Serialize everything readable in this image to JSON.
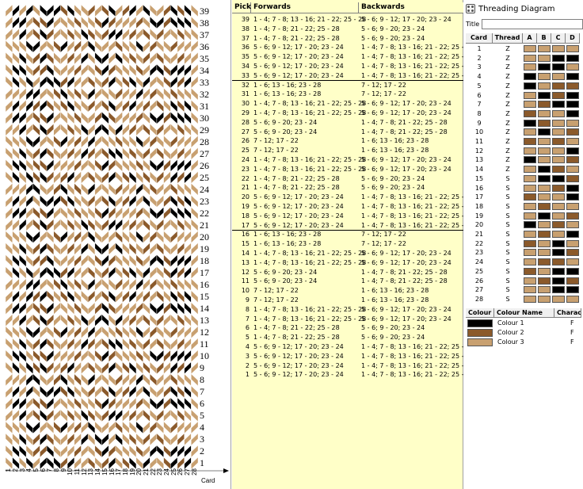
{
  "colors": {
    "colour1": "#000000",
    "colour2": "#8b5a2b",
    "colour3": "#c8a070",
    "panel_yellow": "#ffffc8"
  },
  "pattern": {
    "picks_shown": [
      "39",
      "38",
      "37",
      "36",
      "35",
      "34",
      "33",
      "32",
      "31",
      "30",
      "29",
      "28",
      "27",
      "26",
      "25",
      "24",
      "23",
      "22",
      "21",
      "20",
      "19",
      "18",
      "17",
      "16",
      "15",
      "14",
      "13",
      "12",
      "11",
      "10",
      "9",
      "8",
      "7",
      "6",
      "5",
      "4",
      "3",
      "2",
      "1"
    ],
    "cards_shown": [
      "1",
      "2",
      "3",
      "4",
      "5",
      "6",
      "7",
      "8",
      "9",
      "10",
      "11",
      "12",
      "13",
      "14",
      "15",
      "16",
      "17",
      "18",
      "19",
      "20",
      "21",
      "22",
      "23",
      "24",
      "25",
      "26",
      "27",
      "28"
    ],
    "card_axis_label": "Card"
  },
  "pick_list": {
    "headers": {
      "pick": "Pick",
      "forwards": "Forwards",
      "backwards": "Backwards"
    },
    "rows": [
      {
        "pick": "39",
        "fwd": "1 - 4; 7 - 8; 13 - 16; 21 - 22; 25 - 28",
        "bwd": "5 - 6; 9 - 12; 17 - 20; 23 - 24",
        "end": false
      },
      {
        "pick": "38",
        "fwd": "1 - 4; 7 - 8; 21 - 22; 25 - 28",
        "bwd": "5 - 6; 9 - 20; 23 - 24",
        "end": false
      },
      {
        "pick": "37",
        "fwd": "1 - 4; 7 - 8; 21 - 22; 25 - 28",
        "bwd": "5 - 6; 9 - 20; 23 - 24",
        "end": false
      },
      {
        "pick": "36",
        "fwd": "5 - 6; 9 - 12; 17 - 20; 23 - 24",
        "bwd": "1 - 4; 7 - 8; 13 - 16; 21 - 22; 25 - 28",
        "end": false
      },
      {
        "pick": "35",
        "fwd": "5 - 6; 9 - 12; 17 - 20; 23 - 24",
        "bwd": "1 - 4; 7 - 8; 13 - 16; 21 - 22; 25 - 28",
        "end": false
      },
      {
        "pick": "34",
        "fwd": "5 - 6; 9 - 12; 17 - 20; 23 - 24",
        "bwd": "1 - 4; 7 - 8; 13 - 16; 21 - 22; 25 - 28",
        "end": false
      },
      {
        "pick": "33",
        "fwd": "5 - 6; 9 - 12; 17 - 20; 23 - 24",
        "bwd": "1 - 4; 7 - 8; 13 - 16; 21 - 22; 25 - 28",
        "end": true
      },
      {
        "pick": "32",
        "fwd": "1 - 6; 13 - 16; 23 - 28",
        "bwd": "7 - 12; 17 - 22",
        "end": false
      },
      {
        "pick": "31",
        "fwd": "1 - 6; 13 - 16; 23 - 28",
        "bwd": "7 - 12; 17 - 22",
        "end": false
      },
      {
        "pick": "30",
        "fwd": "1 - 4; 7 - 8; 13 - 16; 21 - 22; 25 - 28",
        "bwd": "5 - 6; 9 - 12; 17 - 20; 23 - 24",
        "end": false
      },
      {
        "pick": "29",
        "fwd": "1 - 4; 7 - 8; 13 - 16; 21 - 22; 25 - 28",
        "bwd": "5 - 6; 9 - 12; 17 - 20; 23 - 24",
        "end": false
      },
      {
        "pick": "28",
        "fwd": "5 - 6; 9 - 20; 23 - 24",
        "bwd": "1 - 4; 7 - 8; 21 - 22; 25 - 28",
        "end": false
      },
      {
        "pick": "27",
        "fwd": "5 - 6; 9 - 20; 23 - 24",
        "bwd": "1 - 4; 7 - 8; 21 - 22; 25 - 28",
        "end": false
      },
      {
        "pick": "26",
        "fwd": "7 - 12; 17 - 22",
        "bwd": "1 - 6; 13 - 16; 23 - 28",
        "end": false
      },
      {
        "pick": "25",
        "fwd": "7 - 12; 17 - 22",
        "bwd": "1 - 6; 13 - 16; 23 - 28",
        "end": false
      },
      {
        "pick": "24",
        "fwd": "1 - 4; 7 - 8; 13 - 16; 21 - 22; 25 - 28",
        "bwd": "5 - 6; 9 - 12; 17 - 20; 23 - 24",
        "end": false
      },
      {
        "pick": "23",
        "fwd": "1 - 4; 7 - 8; 13 - 16; 21 - 22; 25 - 28",
        "bwd": "5 - 6; 9 - 12; 17 - 20; 23 - 24",
        "end": false
      },
      {
        "pick": "22",
        "fwd": "1 - 4; 7 - 8; 21 - 22; 25 - 28",
        "bwd": "5 - 6; 9 - 20; 23 - 24",
        "end": false
      },
      {
        "pick": "21",
        "fwd": "1 - 4; 7 - 8; 21 - 22; 25 - 28",
        "bwd": "5 - 6; 9 - 20; 23 - 24",
        "end": false
      },
      {
        "pick": "20",
        "fwd": "5 - 6; 9 - 12; 17 - 20; 23 - 24",
        "bwd": "1 - 4; 7 - 8; 13 - 16; 21 - 22; 25 - 28",
        "end": false
      },
      {
        "pick": "19",
        "fwd": "5 - 6; 9 - 12; 17 - 20; 23 - 24",
        "bwd": "1 - 4; 7 - 8; 13 - 16; 21 - 22; 25 - 28",
        "end": false
      },
      {
        "pick": "18",
        "fwd": "5 - 6; 9 - 12; 17 - 20; 23 - 24",
        "bwd": "1 - 4; 7 - 8; 13 - 16; 21 - 22; 25 - 28",
        "end": false
      },
      {
        "pick": "17",
        "fwd": "5 - 6; 9 - 12; 17 - 20; 23 - 24",
        "bwd": "1 - 4; 7 - 8; 13 - 16; 21 - 22; 25 - 28",
        "end": true
      },
      {
        "pick": "16",
        "fwd": "1 - 6; 13 - 16; 23 - 28",
        "bwd": "7 - 12; 17 - 22",
        "end": false
      },
      {
        "pick": "15",
        "fwd": "1 - 6; 13 - 16; 23 - 28",
        "bwd": "7 - 12; 17 - 22",
        "end": false
      },
      {
        "pick": "14",
        "fwd": "1 - 4; 7 - 8; 13 - 16; 21 - 22; 25 - 28",
        "bwd": "5 - 6; 9 - 12; 17 - 20; 23 - 24",
        "end": false
      },
      {
        "pick": "13",
        "fwd": "1 - 4; 7 - 8; 13 - 16; 21 - 22; 25 - 28",
        "bwd": "5 - 6; 9 - 12; 17 - 20; 23 - 24",
        "end": false
      },
      {
        "pick": "12",
        "fwd": "5 - 6; 9 - 20; 23 - 24",
        "bwd": "1 - 4; 7 - 8; 21 - 22; 25 - 28",
        "end": false
      },
      {
        "pick": "11",
        "fwd": "5 - 6; 9 - 20; 23 - 24",
        "bwd": "1 - 4; 7 - 8; 21 - 22; 25 - 28",
        "end": false
      },
      {
        "pick": "10",
        "fwd": "7 - 12; 17 - 22",
        "bwd": "1 - 6; 13 - 16; 23 - 28",
        "end": false
      },
      {
        "pick": "9",
        "fwd": "7 - 12; 17 - 22",
        "bwd": "1 - 6; 13 - 16; 23 - 28",
        "end": false
      },
      {
        "pick": "8",
        "fwd": "1 - 4; 7 - 8; 13 - 16; 21 - 22; 25 - 28",
        "bwd": "5 - 6; 9 - 12; 17 - 20; 23 - 24",
        "end": false
      },
      {
        "pick": "7",
        "fwd": "1 - 4; 7 - 8; 13 - 16; 21 - 22; 25 - 28",
        "bwd": "5 - 6; 9 - 12; 17 - 20; 23 - 24",
        "end": false
      },
      {
        "pick": "6",
        "fwd": "1 - 4; 7 - 8; 21 - 22; 25 - 28",
        "bwd": "5 - 6; 9 - 20; 23 - 24",
        "end": false
      },
      {
        "pick": "5",
        "fwd": "1 - 4; 7 - 8; 21 - 22; 25 - 28",
        "bwd": "5 - 6; 9 - 20; 23 - 24",
        "end": false
      },
      {
        "pick": "4",
        "fwd": "5 - 6; 9 - 12; 17 - 20; 23 - 24",
        "bwd": "1 - 4; 7 - 8; 13 - 16; 21 - 22; 25 - 28",
        "end": false
      },
      {
        "pick": "3",
        "fwd": "5 - 6; 9 - 12; 17 - 20; 23 - 24",
        "bwd": "1 - 4; 7 - 8; 13 - 16; 21 - 22; 25 - 28",
        "end": false
      },
      {
        "pick": "2",
        "fwd": "5 - 6; 9 - 12; 17 - 20; 23 - 24",
        "bwd": "1 - 4; 7 - 8; 13 - 16; 21 - 22; 25 - 28",
        "end": false
      },
      {
        "pick": "1",
        "fwd": "5 - 6; 9 - 12; 17 - 20; 23 - 24",
        "bwd": "1 - 4; 7 - 8; 13 - 16; 21 - 22; 25 - 28",
        "end": false
      }
    ]
  },
  "threading": {
    "window_title": "Threading Diagram",
    "title_label": "Title",
    "title_value": "",
    "headers": {
      "card": "Card",
      "thread": "Thread",
      "holes": [
        "A",
        "B",
        "C",
        "D"
      ]
    },
    "cards": [
      {
        "card": "1",
        "thread": "Z",
        "holes": [
          3,
          3,
          3,
          3
        ]
      },
      {
        "card": "2",
        "thread": "Z",
        "holes": [
          3,
          3,
          1,
          1
        ]
      },
      {
        "card": "3",
        "thread": "Z",
        "holes": [
          3,
          1,
          1,
          3
        ]
      },
      {
        "card": "4",
        "thread": "Z",
        "holes": [
          1,
          3,
          3,
          1
        ]
      },
      {
        "card": "5",
        "thread": "Z",
        "holes": [
          1,
          3,
          2,
          2
        ]
      },
      {
        "card": "6",
        "thread": "Z",
        "holes": [
          3,
          1,
          2,
          1
        ]
      },
      {
        "card": "7",
        "thread": "Z",
        "holes": [
          3,
          2,
          1,
          1
        ]
      },
      {
        "card": "8",
        "thread": "Z",
        "holes": [
          2,
          3,
          3,
          1
        ]
      },
      {
        "card": "9",
        "thread": "Z",
        "holes": [
          1,
          2,
          3,
          3
        ]
      },
      {
        "card": "10",
        "thread": "Z",
        "holes": [
          3,
          1,
          3,
          2
        ]
      },
      {
        "card": "11",
        "thread": "Z",
        "holes": [
          2,
          3,
          2,
          3
        ]
      },
      {
        "card": "12",
        "thread": "Z",
        "holes": [
          3,
          3,
          3,
          1
        ]
      },
      {
        "card": "13",
        "thread": "Z",
        "holes": [
          1,
          3,
          3,
          2
        ]
      },
      {
        "card": "14",
        "thread": "Z",
        "holes": [
          3,
          1,
          2,
          3
        ]
      },
      {
        "card": "15",
        "thread": "S",
        "holes": [
          3,
          1,
          1,
          2
        ]
      },
      {
        "card": "16",
        "thread": "S",
        "holes": [
          3,
          3,
          2,
          1
        ]
      },
      {
        "card": "17",
        "thread": "S",
        "holes": [
          2,
          3,
          3,
          1
        ]
      },
      {
        "card": "18",
        "thread": "S",
        "holes": [
          3,
          2,
          3,
          3
        ]
      },
      {
        "card": "19",
        "thread": "S",
        "holes": [
          3,
          1,
          3,
          2
        ]
      },
      {
        "card": "20",
        "thread": "S",
        "holes": [
          1,
          3,
          2,
          3
        ]
      },
      {
        "card": "21",
        "thread": "S",
        "holes": [
          3,
          2,
          3,
          1
        ]
      },
      {
        "card": "22",
        "thread": "S",
        "holes": [
          2,
          3,
          1,
          3
        ]
      },
      {
        "card": "23",
        "thread": "S",
        "holes": [
          3,
          3,
          1,
          2
        ]
      },
      {
        "card": "24",
        "thread": "S",
        "holes": [
          3,
          2,
          2,
          3
        ]
      },
      {
        "card": "25",
        "thread": "S",
        "holes": [
          2,
          3,
          1,
          1
        ]
      },
      {
        "card": "26",
        "thread": "S",
        "holes": [
          3,
          2,
          1,
          2
        ]
      },
      {
        "card": "27",
        "thread": "S",
        "holes": [
          3,
          3,
          1,
          1
        ]
      },
      {
        "card": "28",
        "thread": "S",
        "holes": [
          3,
          3,
          3,
          3
        ]
      }
    ],
    "colour_headers": {
      "colour": "Colour",
      "name": "Colour Name",
      "character": "Characte"
    },
    "colours": [
      {
        "name": "Colour 1",
        "char": "F",
        "key": "colour1"
      },
      {
        "name": "Colour 2",
        "char": "F",
        "key": "colour2"
      },
      {
        "name": "Colour 3",
        "char": "F",
        "key": "colour3"
      }
    ]
  }
}
